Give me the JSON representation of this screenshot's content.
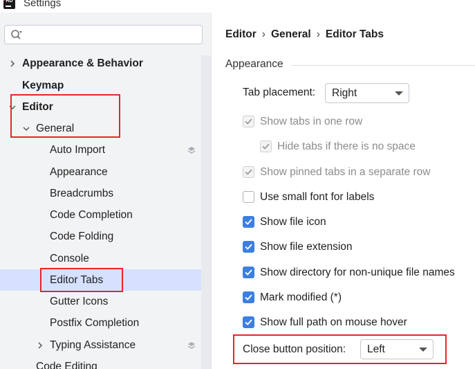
{
  "window": {
    "title": "Settings",
    "app_icon": "RD"
  },
  "search": {
    "value": "",
    "placeholder": ""
  },
  "sidebar": {
    "items": [
      {
        "label": "Appearance & Behavior"
      },
      {
        "label": "Keymap"
      },
      {
        "label": "Editor"
      },
      {
        "label": "General"
      },
      {
        "label": "Auto Import"
      },
      {
        "label": "Appearance"
      },
      {
        "label": "Breadcrumbs"
      },
      {
        "label": "Code Completion"
      },
      {
        "label": "Code Folding"
      },
      {
        "label": "Console"
      },
      {
        "label": "Editor Tabs"
      },
      {
        "label": "Gutter Icons"
      },
      {
        "label": "Postfix Completion"
      },
      {
        "label": "Typing Assistance"
      },
      {
        "label": "Code Editing"
      }
    ],
    "selected": "Editor Tabs"
  },
  "breadcrumb": {
    "items": [
      "Editor",
      "General",
      "Editor Tabs"
    ],
    "separator": "›"
  },
  "main": {
    "section": "Appearance",
    "tab_placement": {
      "label": "Tab placement:",
      "value": "Right"
    },
    "checkboxes": [
      {
        "label": "Show tabs in one row",
        "checked": true,
        "disabled": true
      },
      {
        "label": "Hide tabs if there is no space",
        "checked": true,
        "disabled": true
      },
      {
        "label": "Show pinned tabs in a separate row",
        "checked": true,
        "disabled": true
      },
      {
        "label": "Use small font for labels",
        "checked": false,
        "disabled": false
      },
      {
        "label": "Show file icon",
        "checked": true,
        "disabled": false
      },
      {
        "label": "Show file extension",
        "checked": true,
        "disabled": false
      },
      {
        "label": "Show directory for non-unique file names",
        "checked": true,
        "disabled": false
      },
      {
        "label": "Mark modified (*)",
        "checked": true,
        "disabled": false
      },
      {
        "label": "Show full path on mouse hover",
        "checked": true,
        "disabled": false
      }
    ],
    "close_button": {
      "label": "Close button position:",
      "value": "Left"
    }
  },
  "colors": {
    "accent": "#3c7fe0",
    "selection": "#d5e1ff",
    "highlight": "#e5262a"
  }
}
